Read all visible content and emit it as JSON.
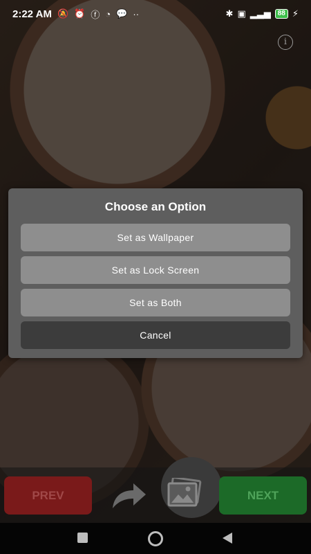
{
  "status_bar": {
    "time": "2:22 AM",
    "battery": "88"
  },
  "dialog": {
    "title": "Choose an Option",
    "options": [
      {
        "label": "Set as Wallpaper"
      },
      {
        "label": "Set as Lock Screen"
      },
      {
        "label": "Set as Both"
      }
    ],
    "cancel_label": "Cancel"
  },
  "controls": {
    "prev_label": "PREV",
    "next_label": "NEXT",
    "share_icon": "share-arrow-icon",
    "wallpaper_icon": "wallpaper-image-icon"
  },
  "colors": {
    "prev": "#7a1a1a",
    "next": "#1c6a28",
    "dialog_bg": "#5e5e5e",
    "option_bg": "#8e8e8e",
    "cancel_bg": "#3c3c3c"
  }
}
